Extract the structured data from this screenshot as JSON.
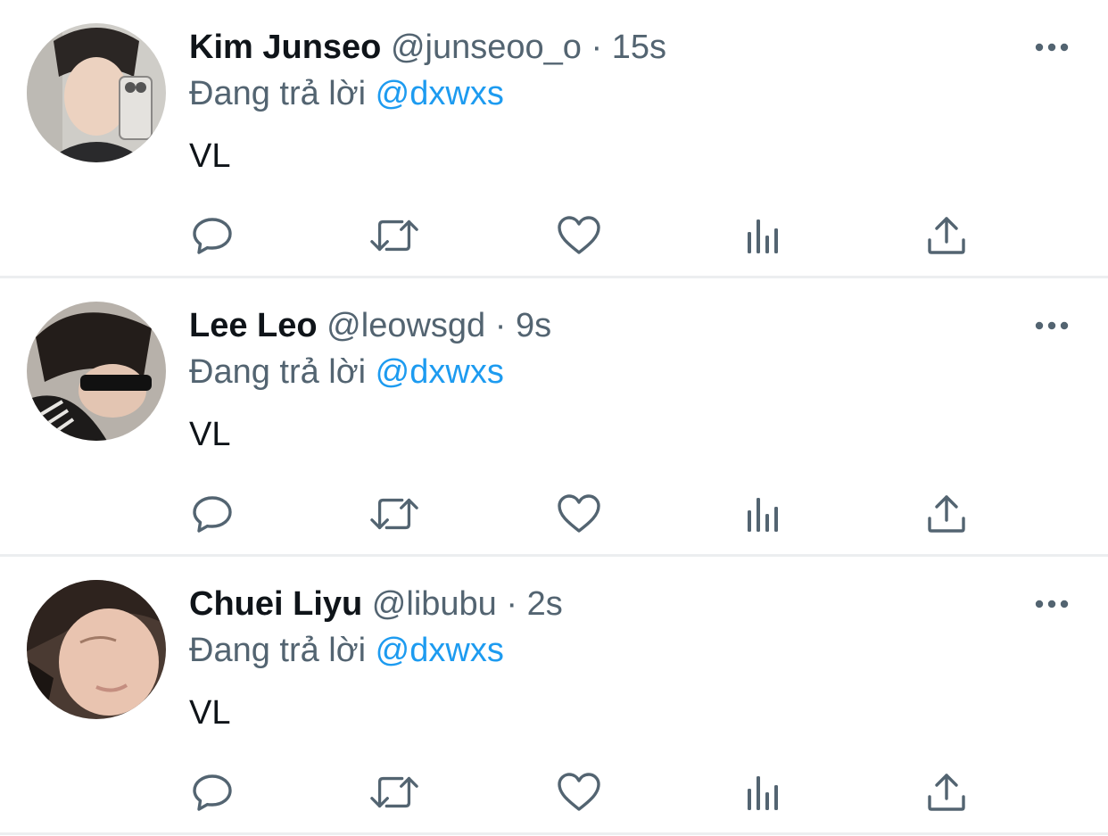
{
  "tweets": [
    {
      "display_name": "Kim Junseo",
      "handle": "@junseoo_o",
      "separator": "·",
      "time": "15s",
      "reply_prefix": "Đang trả lời",
      "reply_to": "@dxwxs",
      "text": "VL"
    },
    {
      "display_name": "Lee Leo",
      "handle": "@leowsgd",
      "separator": "·",
      "time": "9s",
      "reply_prefix": "Đang trả lời",
      "reply_to": "@dxwxs",
      "text": "VL"
    },
    {
      "display_name": "Chuei Liyu",
      "handle": "@libubu",
      "separator": "·",
      "time": "2s",
      "reply_prefix": "Đang trả lời",
      "reply_to": "@dxwxs",
      "text": "VL"
    }
  ],
  "action_icons": [
    "reply-icon",
    "retweet-icon",
    "like-icon",
    "analytics-icon",
    "share-icon"
  ],
  "colors": {
    "name": "#0f1419",
    "secondary": "#536471",
    "mention": "#1d9bf0",
    "icon": "#536471",
    "divider": "#eceef0"
  }
}
